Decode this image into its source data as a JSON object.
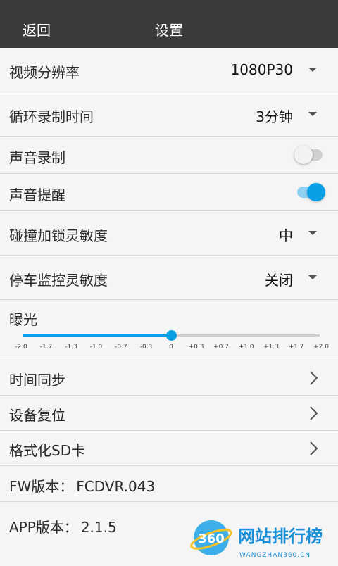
{
  "header": {
    "back_label": "返回",
    "title": "设置"
  },
  "settings": {
    "resolution": {
      "label": "视频分辨率",
      "value": "1080P30"
    },
    "loop_record": {
      "label": "循环录制时间",
      "value": "3分钟"
    },
    "audio_record": {
      "label": "声音录制",
      "on": false
    },
    "audio_prompt": {
      "label": "声音提醒",
      "on": true
    },
    "collision_sensitivity": {
      "label": "碰撞加锁灵敏度",
      "value": "中"
    },
    "parking_sensitivity": {
      "label": "停车监控灵敏度",
      "value": "关闭"
    },
    "exposure": {
      "label": "曝光",
      "ticks": [
        "-2.0",
        "-1.7",
        "-1.3",
        "-1.0",
        "-0.7",
        "-0.3",
        "0",
        "+0.3",
        "+0.7",
        "+1.0",
        "+1.3",
        "+1.7",
        "+2.0"
      ],
      "value": "0"
    },
    "time_sync": {
      "label": "时间同步"
    },
    "device_reset": {
      "label": "设备复位"
    },
    "format_sd": {
      "label": "格式化SD卡"
    },
    "fw_version": {
      "label": "FW版本：",
      "value": "FCDVR.043"
    },
    "app_version": {
      "label": "APP版本：",
      "value": "2.1.5"
    }
  },
  "watermark": {
    "number": "360",
    "brand": "网站排行榜",
    "url": "WANGZHAN360.CN"
  },
  "colors": {
    "accent": "#0aa0e6",
    "header_bg": "#3b3b3b",
    "background": "#f5f5f5"
  }
}
